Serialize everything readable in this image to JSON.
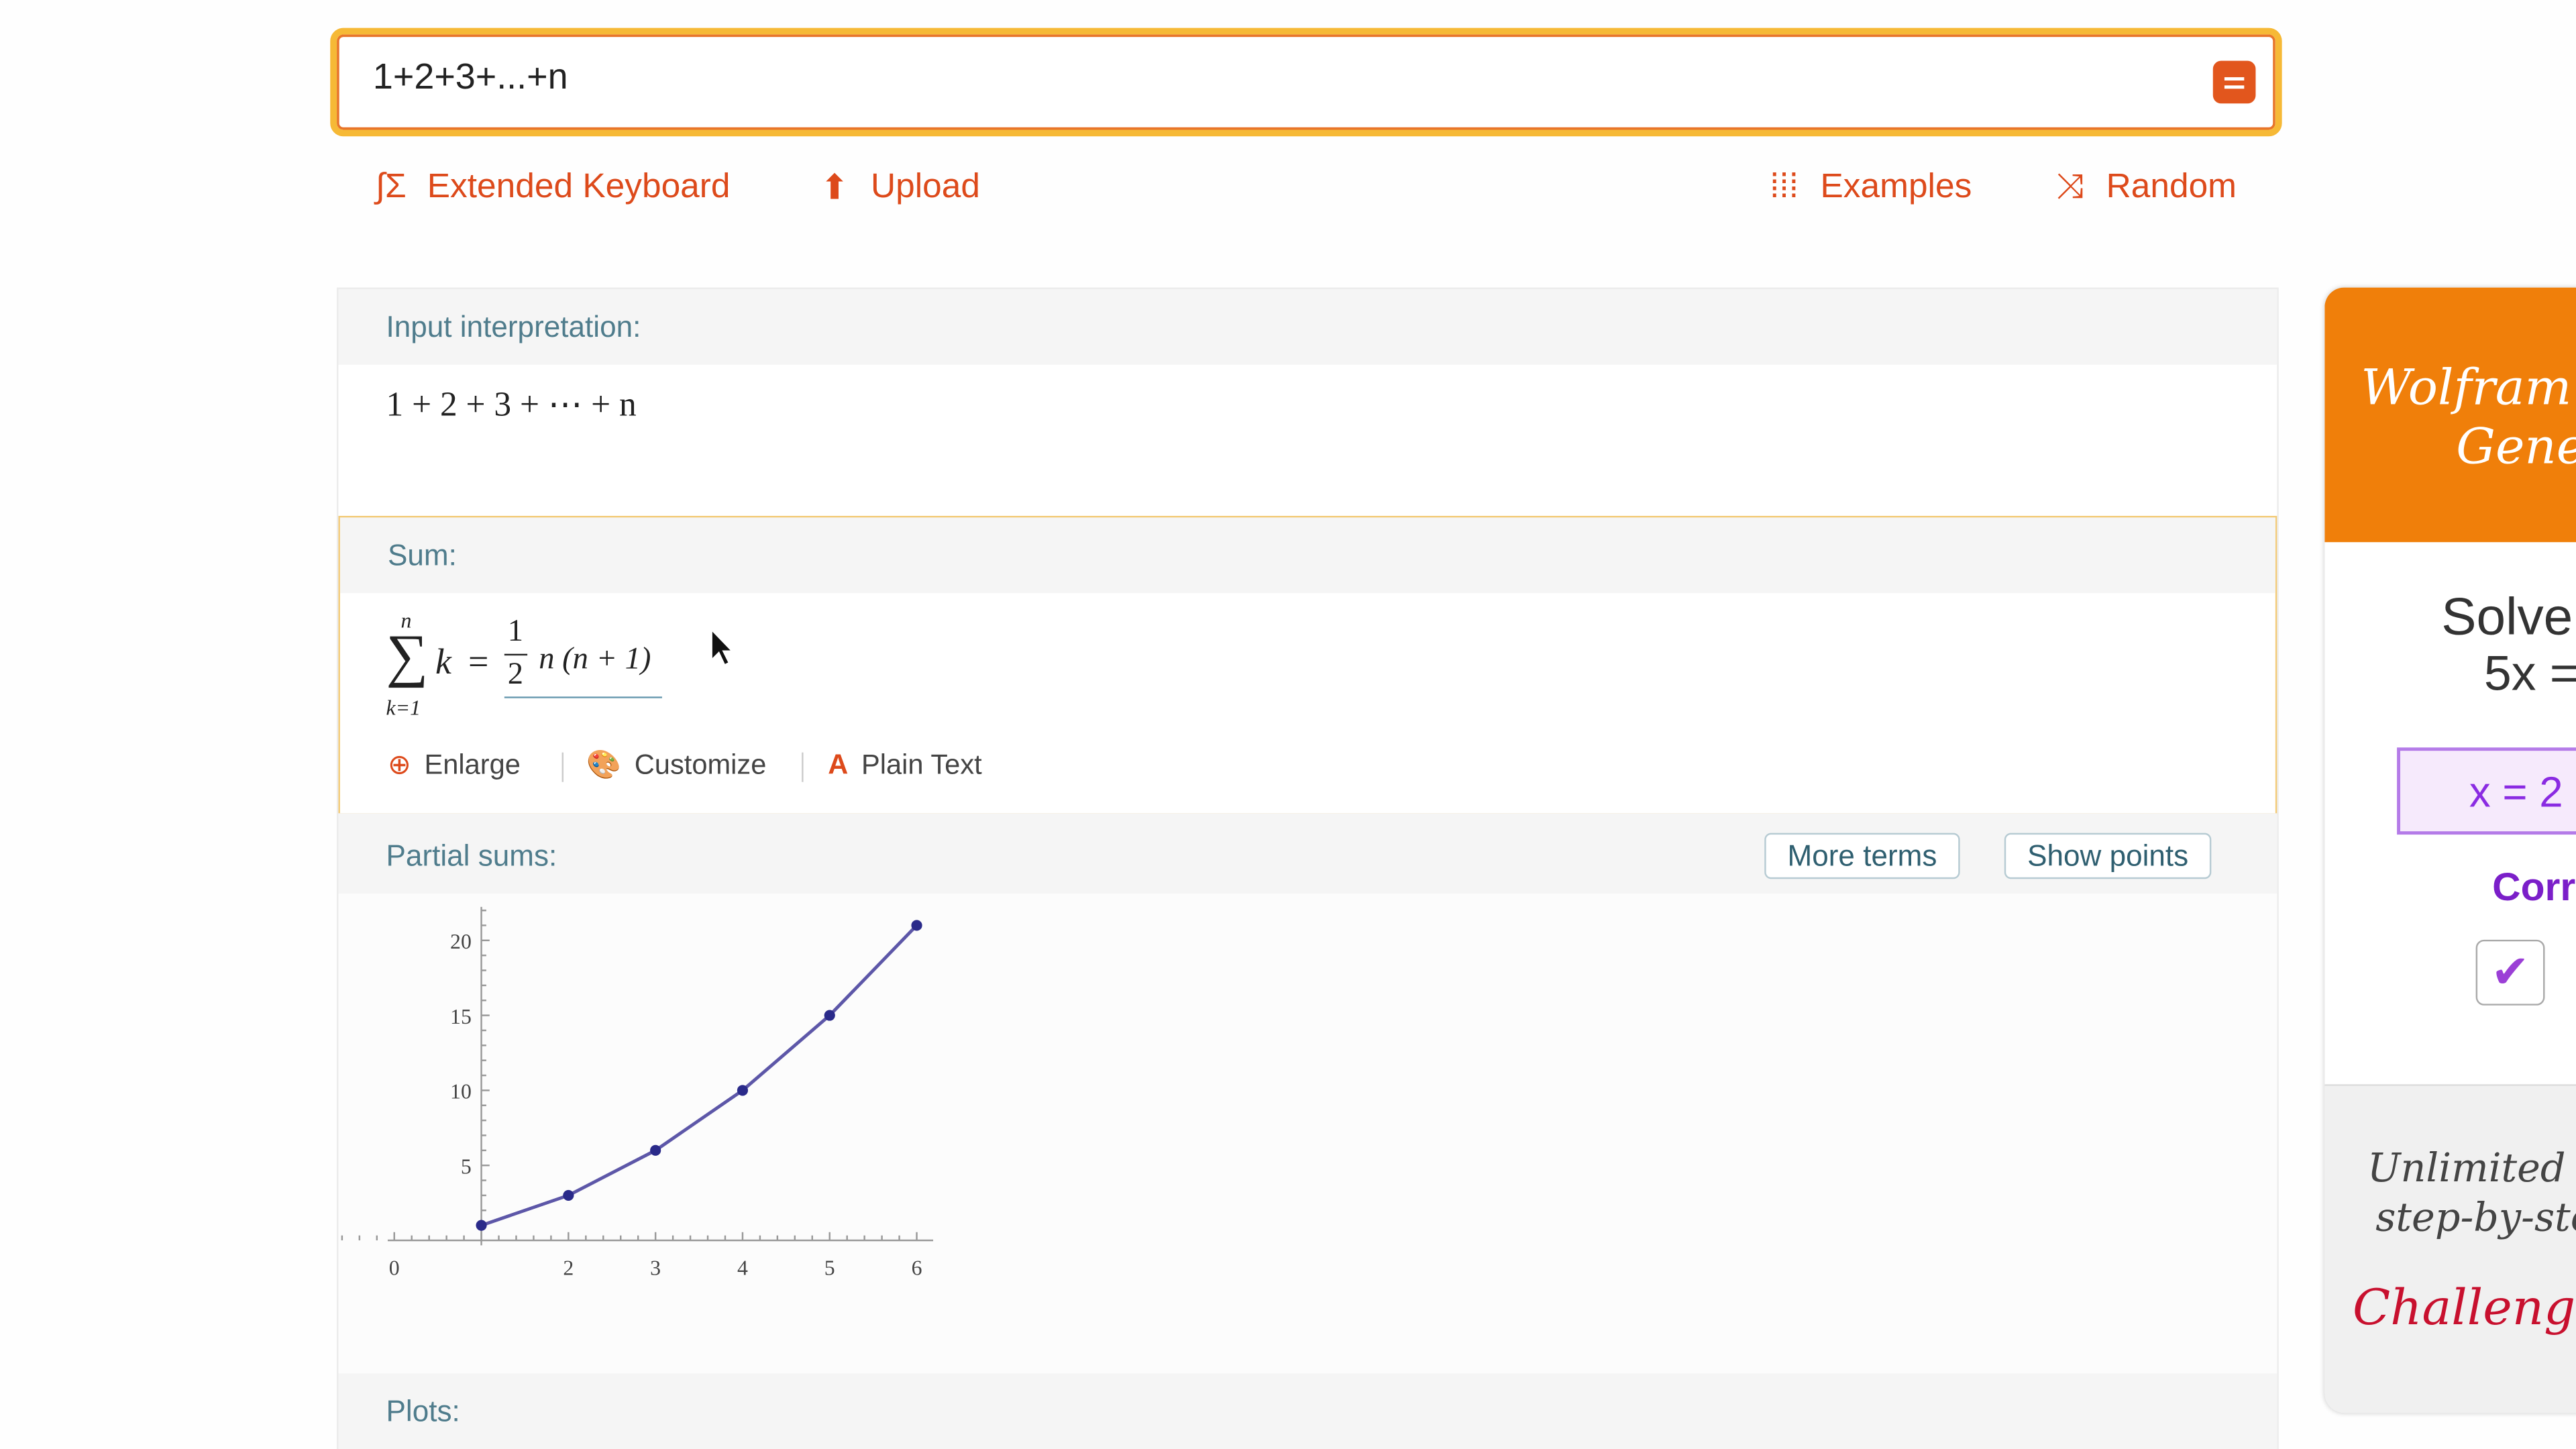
{
  "search": {
    "value": "1+2+3+...+n",
    "equals_icon": "equals-icon"
  },
  "links": {
    "extended_keyboard": "Extended Keyboard",
    "upload": "Upload",
    "examples": "Examples",
    "random": "Random"
  },
  "pods": {
    "input": {
      "title": "Input interpretation:",
      "formula": "1 + 2 + 3 + ⋯ + n"
    },
    "sum": {
      "title": "Sum:",
      "upper": "n",
      "lower": "k=1",
      "summand": "k",
      "eq": "=",
      "num": "1",
      "den": "2",
      "rhs": "n (n + 1)",
      "actions": {
        "enlarge": "Enlarge",
        "customize": "Customize",
        "plain_text": "Plain Text"
      }
    },
    "partial": {
      "title": "Partial sums:",
      "more_terms": "More terms",
      "show_points": "Show points"
    },
    "plots": {
      "title": "Plots:"
    }
  },
  "chart_data": {
    "type": "line",
    "x": [
      1,
      2,
      3,
      4,
      5,
      6
    ],
    "values": [
      1,
      3,
      6,
      10,
      15,
      21
    ],
    "xlim": [
      0,
      6
    ],
    "ylim": [
      0,
      22
    ],
    "xticks": [
      "0",
      "2",
      "3",
      "4",
      "5",
      "6"
    ],
    "yticks": [
      "5",
      "10",
      "15",
      "20"
    ],
    "color": "#5d57a8",
    "point_color": "#2a2a8a",
    "markers": true,
    "grid": false
  },
  "promo": {
    "header_l1": "Wolfram",
    "header_l2": "Gene",
    "q1": "Solve",
    "q2": "5x =",
    "answer": "x = 2",
    "correct": "Corr",
    "f1": "Unlimited p",
    "f2": "step-by-ste",
    "challenge": "Challenge",
    "accent": "#f07f0a",
    "purple": "#8a2be2",
    "red": "#c8102e"
  },
  "colors": {
    "link": "#dd4a1b",
    "search_border": "#f6b936",
    "pod_title": "#4f7c8c"
  }
}
